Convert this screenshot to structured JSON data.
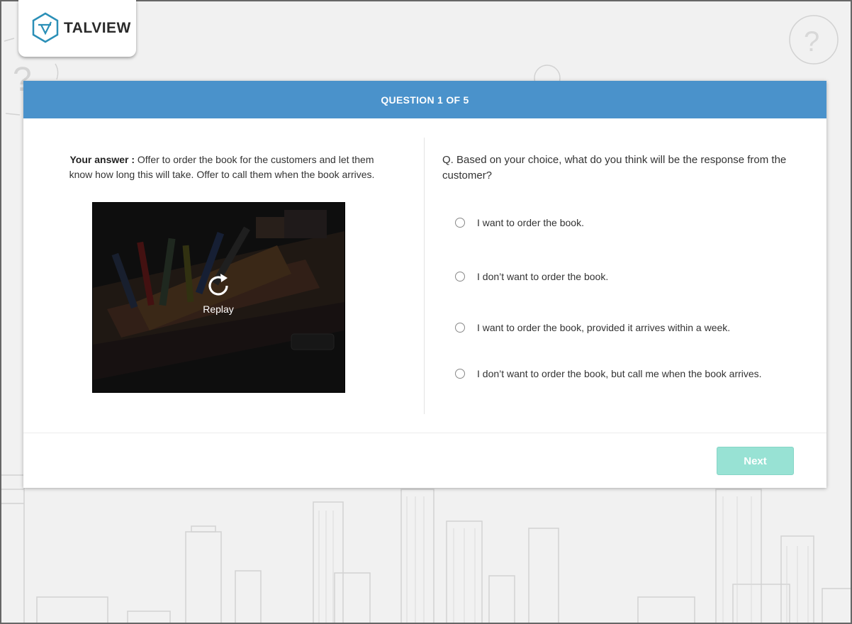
{
  "brand": {
    "name": "TALVIEW",
    "accent": "#4a92cb",
    "logo_color": "#2a8fb7"
  },
  "header": {
    "progress_label": "QUESTION 1 OF 5"
  },
  "answer": {
    "prefix": "Your answer :",
    "text": "Offer to order the book for the customers and let them know how long this will take. Offer to call them when the book arrives."
  },
  "video": {
    "replay_label": "Replay",
    "icon": "replay-icon"
  },
  "question": {
    "text": "Q. Based on your choice, what do you think will be the response from the customer?",
    "options": [
      {
        "label": "I want to order the book."
      },
      {
        "label": "I don’t want to order the book."
      },
      {
        "label": "I want to order the book, provided it arrives within a week."
      },
      {
        "label": "I don’t want to order the book, but call me when the book arrives."
      }
    ]
  },
  "footer": {
    "next_label": "Next",
    "next_color": "#98e2d4"
  }
}
